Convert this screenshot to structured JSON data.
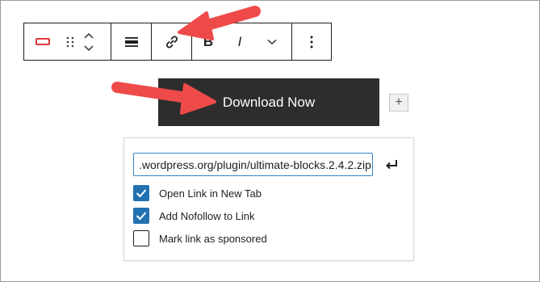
{
  "toolbar": {
    "block_type_icon": "button-block-icon",
    "drag_icon": "drag-handle-icon",
    "move_up_icon": "chevron-up-icon",
    "move_down_icon": "chevron-down-icon",
    "align_icon": "align-icon",
    "link_icon": "link-icon",
    "bold_label": "B",
    "italic_label": "I",
    "more_icon": "chevron-down-icon",
    "options_icon": "more-vertical-icon"
  },
  "button": {
    "label": "Download Now",
    "add_label": "+"
  },
  "link_popover": {
    "url_value": ".wordpress.org/plugin/ultimate-blocks.2.4.2.zip",
    "submit_icon": "enter-icon",
    "options": [
      {
        "label": "Open Link in New Tab",
        "checked": true
      },
      {
        "label": "Add Nofollow to Link",
        "checked": true
      },
      {
        "label": "Mark link as sponsored",
        "checked": false
      }
    ]
  },
  "colors": {
    "accent": "#2271b1",
    "arrow": "#ef4a4a",
    "button_bg": "#2d2d2d",
    "block_icon": "#e2363e"
  }
}
